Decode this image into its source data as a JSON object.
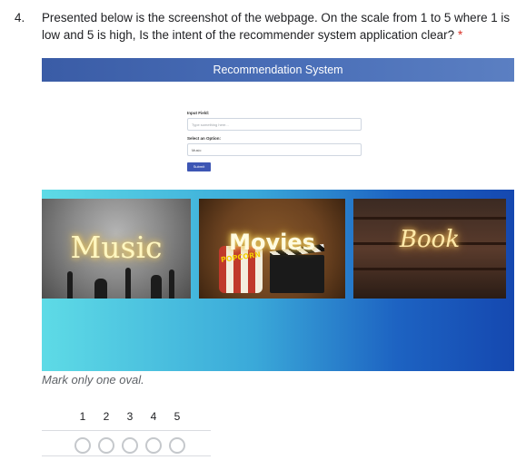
{
  "question": {
    "number": "4.",
    "text": "Presented below is the screenshot of the webpage. On the scale from 1 to 5 where 1 is low and 5 is high, Is the intent of the recommender system application clear?",
    "required_marker": "*"
  },
  "screenshot": {
    "banner_title": "Recommendation System",
    "form": {
      "input_label": "Input Field:",
      "input_placeholder": "Type something here...",
      "select_label": "Select an Option:",
      "select_value": "Music",
      "submit_label": "Submit"
    },
    "cards": [
      {
        "name": "music",
        "title": "Music"
      },
      {
        "name": "movies",
        "title": "Movies",
        "sub_label": "POPCORN"
      },
      {
        "name": "book",
        "title": "Book"
      }
    ]
  },
  "instruction": "Mark only one oval.",
  "scale": {
    "labels": [
      "1",
      "2",
      "3",
      "4",
      "5"
    ]
  },
  "colors": {
    "banner": "#4a6fb8",
    "required": "#d93025",
    "gallery_start": "#5edbe6",
    "gallery_end": "#1548b0",
    "submit": "#3d56b4"
  }
}
